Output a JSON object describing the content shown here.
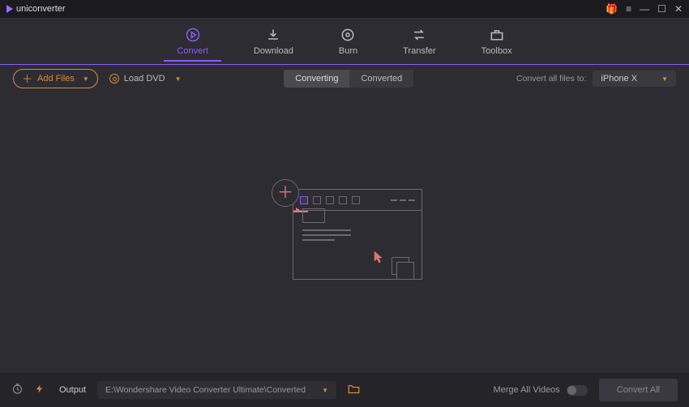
{
  "app": {
    "name": "uniconverter"
  },
  "tabs": {
    "convert": "Convert",
    "download": "Download",
    "burn": "Burn",
    "transfer": "Transfer",
    "toolbox": "Toolbox"
  },
  "subbar": {
    "add_files": "Add Files",
    "load_dvd": "Load DVD",
    "subtab_converting": "Converting",
    "subtab_converted": "Converted",
    "convert_all_label": "Convert all files to:",
    "target_format": "iPhone X"
  },
  "bottom": {
    "output_label": "Output",
    "output_path": "E:\\Wondershare Video Converter Ultimate\\Converted",
    "merge_label": "Merge All Videos",
    "convert_all_btn": "Convert All"
  }
}
